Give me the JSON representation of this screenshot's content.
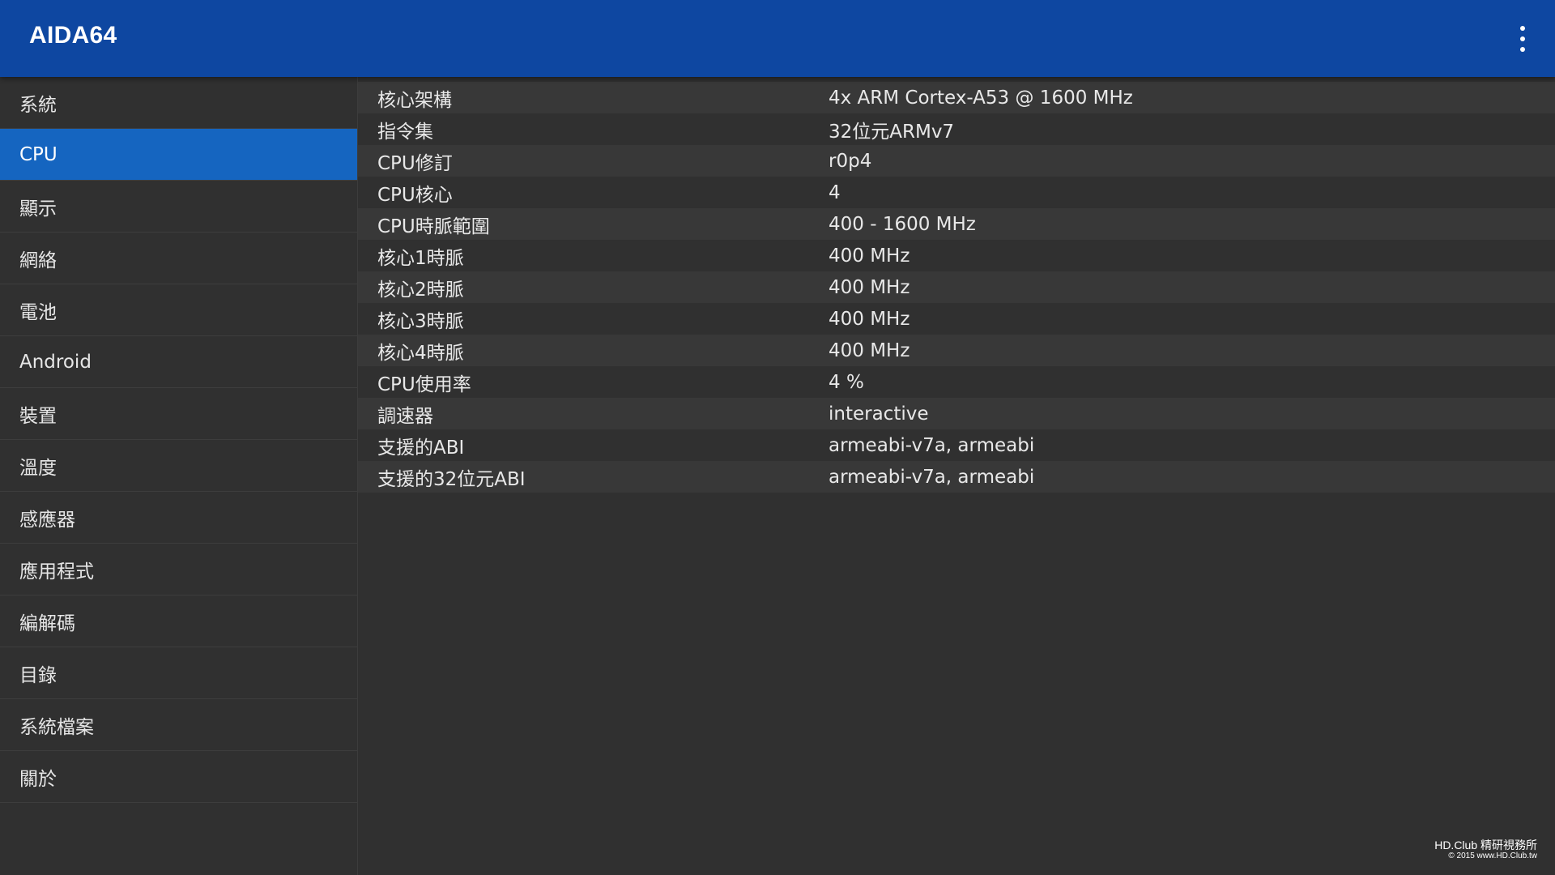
{
  "appbar": {
    "title": "AIDA64",
    "menu_icon": "more-vert-icon"
  },
  "sidebar": {
    "active_index": 1,
    "items": [
      {
        "label": "系統"
      },
      {
        "label": "CPU"
      },
      {
        "label": "顯示"
      },
      {
        "label": "網絡"
      },
      {
        "label": "電池"
      },
      {
        "label": "Android"
      },
      {
        "label": "裝置"
      },
      {
        "label": "溫度"
      },
      {
        "label": "感應器"
      },
      {
        "label": "應用程式"
      },
      {
        "label": "編解碼"
      },
      {
        "label": "目錄"
      },
      {
        "label": "系統檔案"
      },
      {
        "label": "關於"
      }
    ]
  },
  "details": {
    "rows": [
      {
        "label": "核心架構",
        "value": "4x ARM Cortex-A53 @ 1600 MHz"
      },
      {
        "label": "指令集",
        "value": "32位元ARMv7"
      },
      {
        "label": "CPU修訂",
        "value": "r0p4"
      },
      {
        "label": "CPU核心",
        "value": "4"
      },
      {
        "label": "CPU時脈範圍",
        "value": "400 - 1600 MHz"
      },
      {
        "label": "核心1時脈",
        "value": "400 MHz"
      },
      {
        "label": "核心2時脈",
        "value": "400 MHz"
      },
      {
        "label": "核心3時脈",
        "value": "400 MHz"
      },
      {
        "label": "核心4時脈",
        "value": "400 MHz"
      },
      {
        "label": "CPU使用率",
        "value": "4 %"
      },
      {
        "label": "調速器",
        "value": "interactive"
      },
      {
        "label": "支援的ABI",
        "value": "armeabi-v7a, armeabi"
      },
      {
        "label": "支援的32位元ABI",
        "value": "armeabi-v7a, armeabi"
      }
    ]
  },
  "watermark": {
    "line1": "HD.Club 精研視務所",
    "line2": "© 2015  www.HD.Club.tw"
  },
  "colors": {
    "appbar": "#0e47a1",
    "active_item": "#1565c0",
    "background": "#303030",
    "row_alt": "#383838"
  }
}
